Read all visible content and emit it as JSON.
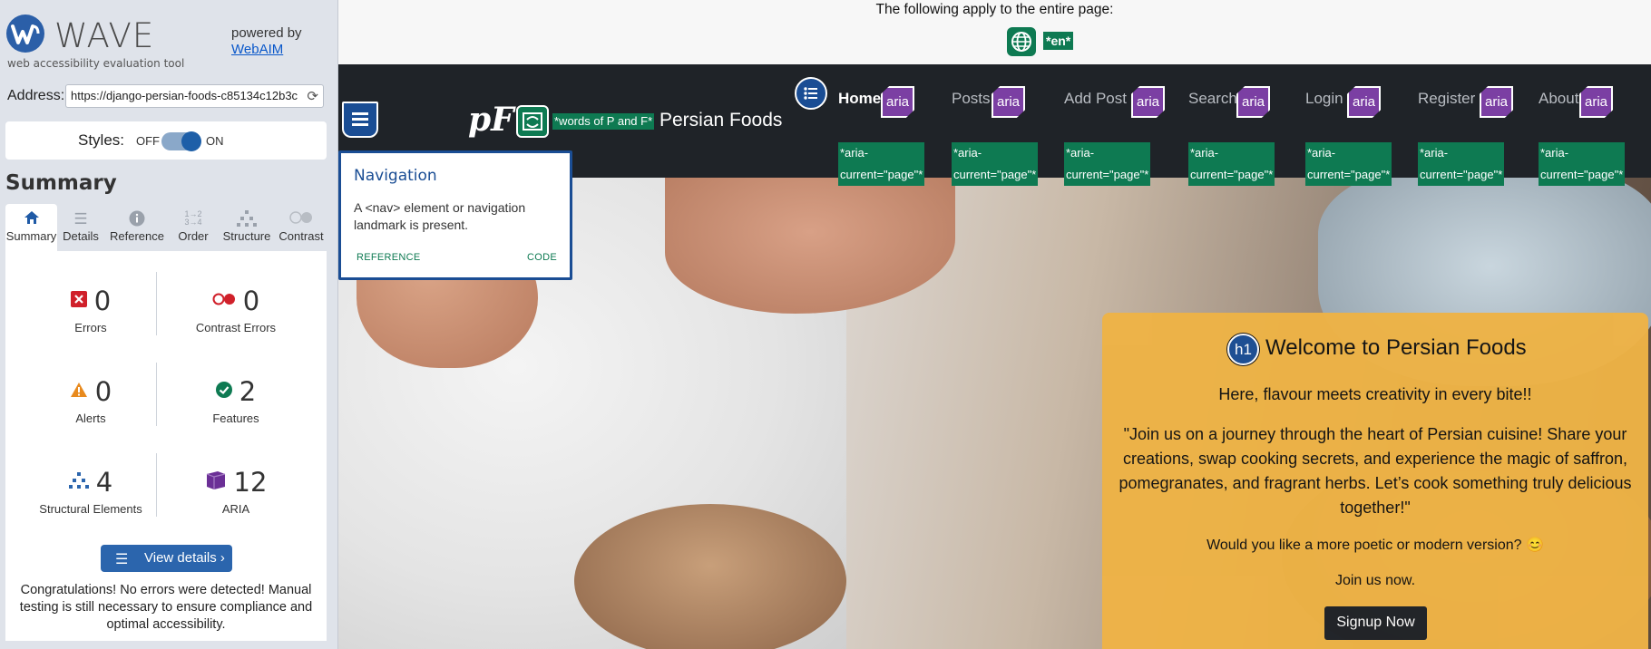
{
  "wave": {
    "logo_text": "WAVE",
    "tagline": "web accessibility evaluation tool",
    "powered_by": "powered by",
    "webaim_link": "WebAIM",
    "address_label": "Address:",
    "address_value": "https://django-persian-foods-c85134c12b3c",
    "styles_label": "Styles:",
    "styles_off": "OFF",
    "styles_on": "ON",
    "summary_heading": "Summary",
    "tabs": [
      {
        "label": "Summary",
        "icon": "home-icon"
      },
      {
        "label": "Details",
        "icon": "list-icon"
      },
      {
        "label": "Reference",
        "icon": "info-icon"
      },
      {
        "label": "Order",
        "icon": "order-icon"
      },
      {
        "label": "Structure",
        "icon": "structure-icon"
      },
      {
        "label": "Contrast",
        "icon": "contrast-icon"
      }
    ],
    "stats": {
      "errors": {
        "value": "0",
        "label": "Errors"
      },
      "contrast_errors": {
        "value": "0",
        "label": "Contrast Errors"
      },
      "alerts": {
        "value": "0",
        "label": "Alerts"
      },
      "features": {
        "value": "2",
        "label": "Features"
      },
      "structural": {
        "value": "4",
        "label": "Structural Elements"
      },
      "aria": {
        "value": "12",
        "label": "ARIA"
      }
    },
    "view_details": "View details ›",
    "congrats": "Congratulations! No errors were detected! Manual testing is still necessary to ensure compliance and optimal accessibility."
  },
  "page": {
    "apply_text": "The following apply to the entire page:",
    "lang_tag": "*en*",
    "alt_tag": "*words of P and F*",
    "brand_name": "Persian Foods",
    "aria_icon_text": "aria",
    "aria_tag_line1": "*aria-",
    "aria_tag_line2": "current=\"page\"*",
    "nav": [
      "Home",
      "Posts",
      "Add Post",
      "Search",
      "Login",
      "Register",
      "About"
    ],
    "tooltip": {
      "title": "Navigation",
      "body": "A <nav> element or navigation landmark is present.",
      "reference": "REFERENCE",
      "code": "CODE"
    },
    "card": {
      "h1_badge": "h1",
      "title": "Welcome to Persian Foods",
      "subtitle": "Here, flavour meets creativity in every bite!!",
      "quote": "\"Join us on a journey through the heart of Persian cuisine! Share your creations, swap cooking secrets, and experience the magic of saffron, pomegranates, and fragrant herbs. Let’s cook something truly delicious together!\"",
      "question": "Would you like a more poetic or modern version? 😊",
      "join": "Join us now.",
      "button": "Signup Now"
    }
  },
  "colors": {
    "wave_blue": "#1a4d94",
    "feature_green": "#0e7a52",
    "aria_purple": "#7b3fa3",
    "navbar": "#1f2328",
    "card_orange": "#eeb346"
  }
}
